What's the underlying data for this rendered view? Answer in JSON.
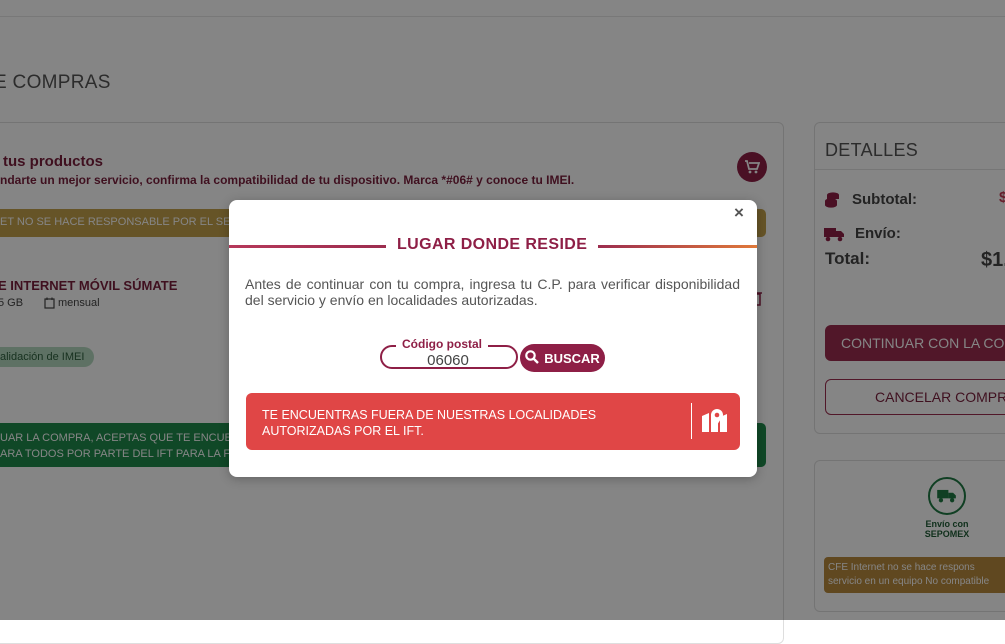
{
  "page": {
    "title": "E COMPRAS"
  },
  "cart": {
    "heading": "tus productos",
    "subtext": "ndarte un mejor servicio, confirma la compatibilidad de tu dispositivo. Marca *#06# y conoce tu IMEI.",
    "warning": "ET NO SE HACE RESPONSABLE POR EL SE",
    "product": {
      "name": "E INTERNET MÓVIL SÚMATE",
      "data": "5 GB",
      "period": "mensual"
    },
    "imei_badge": "alidación de IMEI",
    "terms_line1": "UAR LA COMPRA, ACEPTAS QUE TE ENCUE",
    "terms_line2": "ARA TODOS POR PARTE DEL IFT PARA LA F"
  },
  "details": {
    "title": "DETALLES",
    "subtotal_label": "Subtotal:",
    "subtotal_value": "$",
    "envio_label": "Envío:",
    "total_label": "Total:",
    "total_value": "$1,",
    "continue_label": "CONTINUAR CON LA CO",
    "cancel_label": "CANCELAR COMPR"
  },
  "shipping": {
    "label": "Envío con SEPOMEX",
    "note_line1": "CFE  Internet  no  se  hace  respons",
    "note_line2": "servicio en un equipo No compatible"
  },
  "modal": {
    "close": "×",
    "title": "LUGAR DONDE RESIDE",
    "description": "Antes de continuar con tu compra, ingresa tu C.P. para verificar disponibilidad del servicio y envío en localidades autorizadas.",
    "postal_label": "Código postal",
    "postal_value": "06060",
    "search_label": "BUSCAR",
    "alert_text": "TE ENCUENTRAS FUERA DE NUESTRAS LOCALIDADES AUTORIZADAS POR EL IFT."
  },
  "colors": {
    "brand": "#8e1f46",
    "alert": "#e04646",
    "warning": "#c4a14b",
    "success": "#1f8a4c"
  }
}
